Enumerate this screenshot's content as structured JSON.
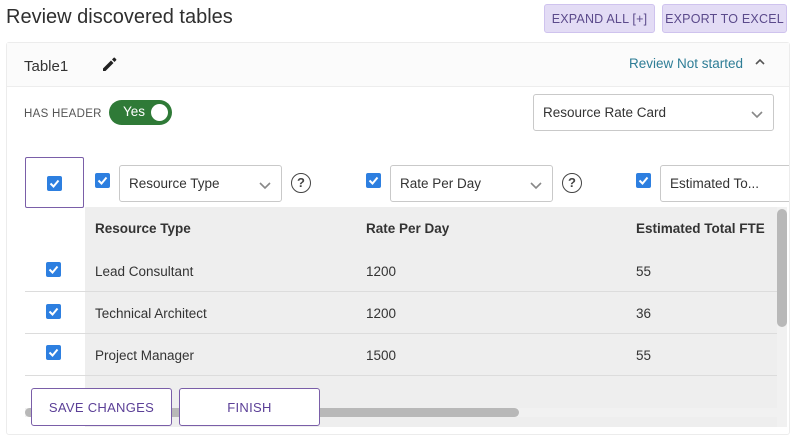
{
  "page": {
    "title": "Review discovered tables"
  },
  "toolbar": {
    "expand_all_label": "EXPAND ALL [+]",
    "export_label": "EXPORT TO EXCEL"
  },
  "table_card": {
    "name": "Table1",
    "review_status": "Review Not started",
    "has_header_label": "HAS HEADER",
    "has_header_toggle": "Yes",
    "table_type_selected": "Resource Rate Card",
    "column_mappings": [
      {
        "selected": "Resource Type",
        "checked": true,
        "help": "?"
      },
      {
        "selected": "Rate Per Day",
        "checked": true,
        "help": "?"
      },
      {
        "selected": "Estimated To...",
        "checked": true
      }
    ],
    "columns": [
      "Resource Type",
      "Rate Per Day",
      "Estimated Total FTE"
    ],
    "rows": [
      [
        "Lead Consultant",
        "1200",
        "55"
      ],
      [
        "Technical Architect",
        "1200",
        "36"
      ],
      [
        "Project Manager",
        "1500",
        "55"
      ]
    ]
  },
  "actions": {
    "save_label": "SAVE CHANGES",
    "finish_label": "FINISH"
  },
  "icons": {
    "edit": "pencil-icon",
    "collapse": "chevron-up-icon",
    "dropdown": "chevron-down-icon",
    "help": "question-circle-icon",
    "check": "checkbox-checked-icon"
  },
  "colors": {
    "accent": "#7a5ea8",
    "toggle_on": "#2f7a37",
    "checkbox": "#2d7fe0",
    "status_link": "#2e7d96",
    "top_button_bg": "#e3dcf5"
  }
}
